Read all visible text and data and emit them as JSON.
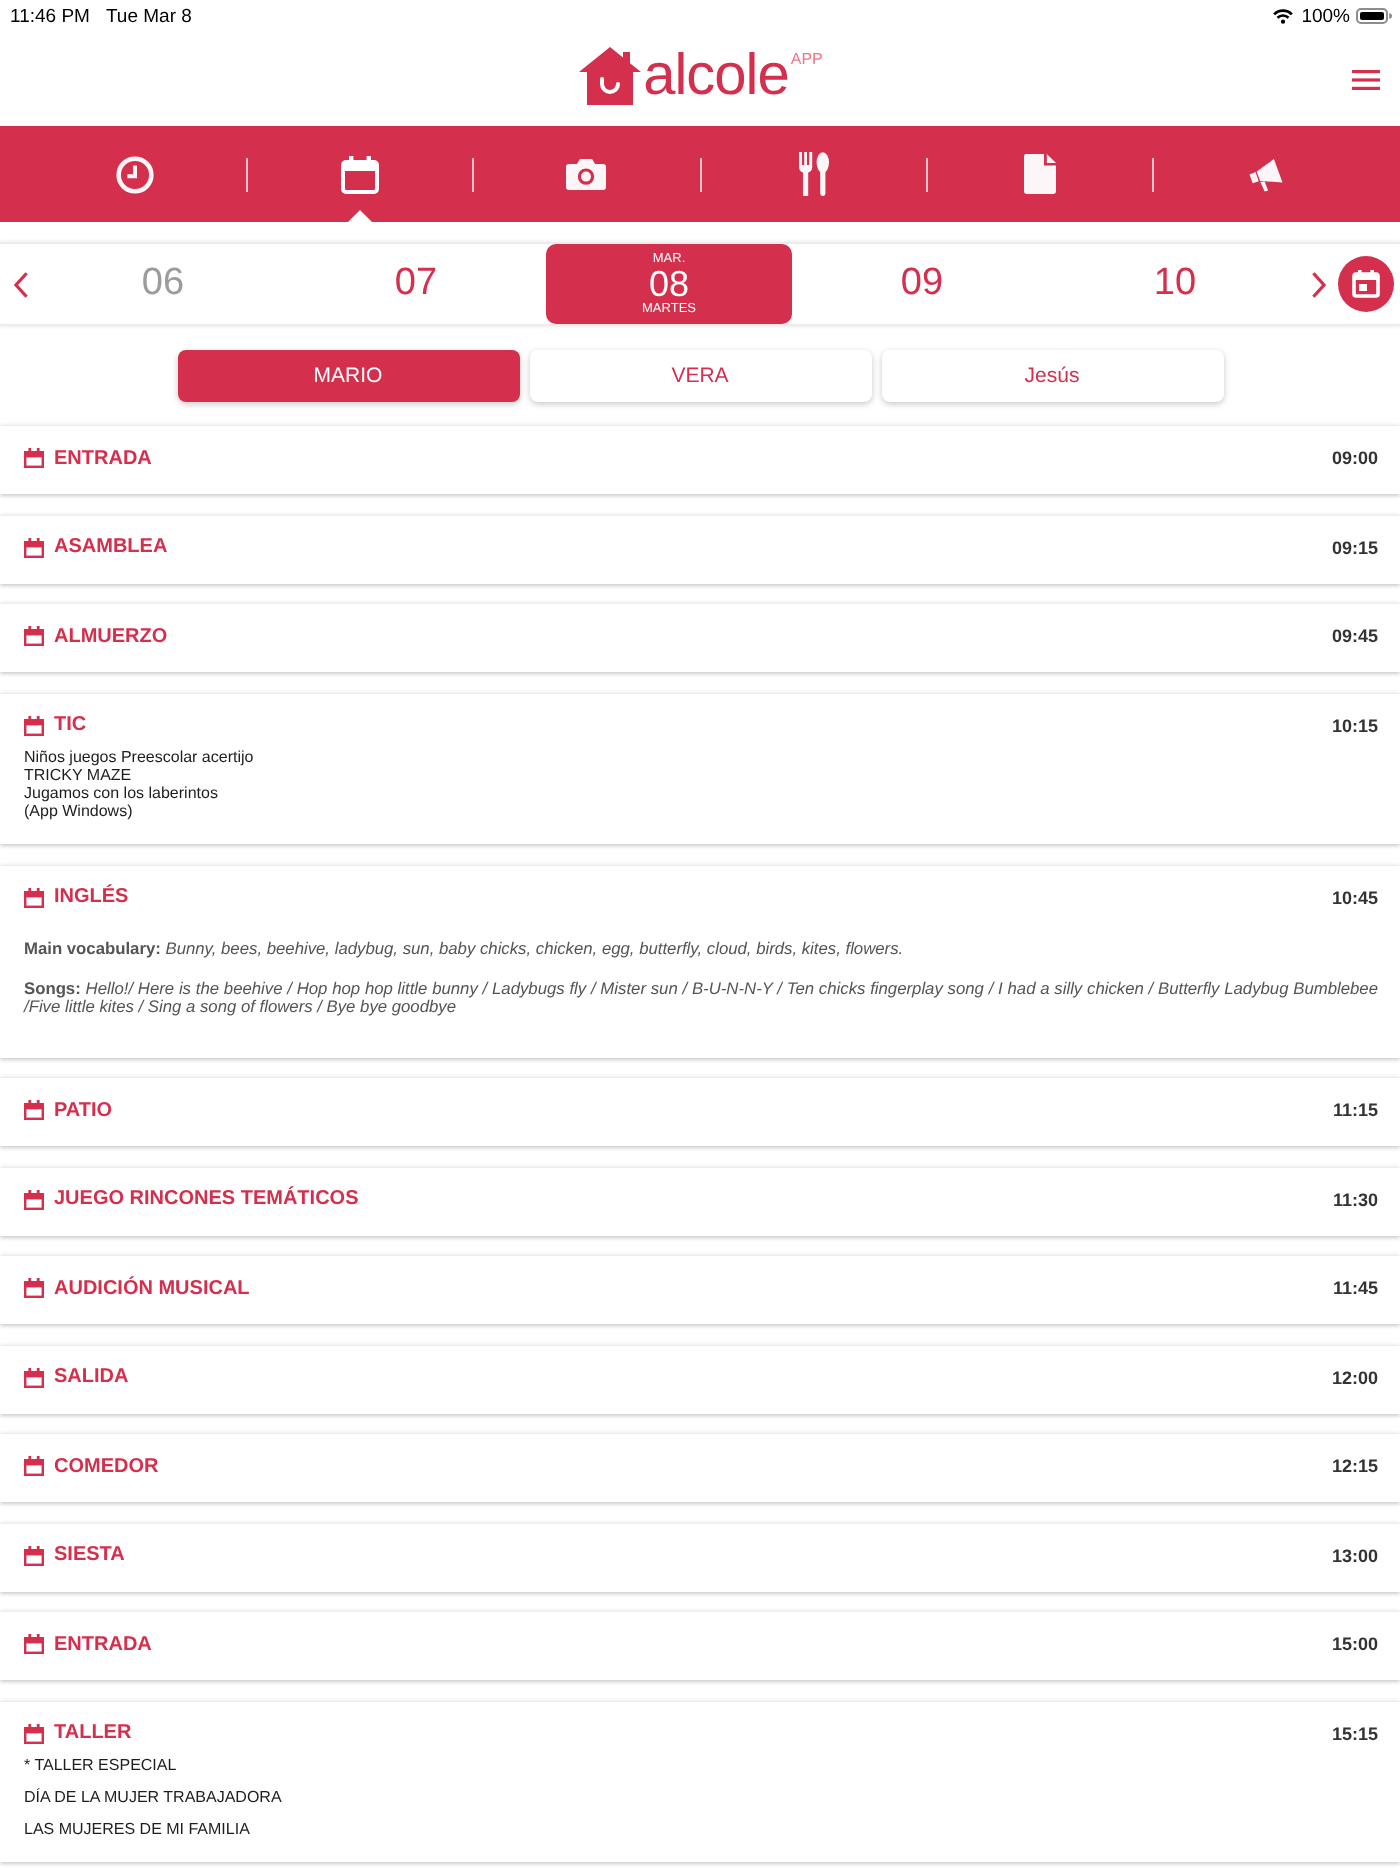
{
  "status_bar": {
    "time": "11:46 PM",
    "date": "Tue Mar 8",
    "battery": "100%"
  },
  "header": {
    "logo": "alcole",
    "badge": "APP"
  },
  "nav_tabs": [
    {
      "kind": "clock",
      "selected": false
    },
    {
      "kind": "calendar",
      "selected": true
    },
    {
      "kind": "camera",
      "selected": false
    },
    {
      "kind": "utensils",
      "selected": false
    },
    {
      "kind": "document",
      "selected": false
    },
    {
      "kind": "megaphone",
      "selected": false
    }
  ],
  "date_strip": {
    "days": [
      {
        "day": "06",
        "selected": false,
        "disabled": true
      },
      {
        "day": "07",
        "selected": false,
        "disabled": false
      },
      {
        "weekday_short": "MAR.",
        "day": "08",
        "weekday": "MARTES",
        "selected": true,
        "disabled": false
      },
      {
        "day": "09",
        "selected": false,
        "disabled": false
      },
      {
        "day": "10",
        "selected": false,
        "disabled": false
      }
    ]
  },
  "students": [
    {
      "name": "MARIO",
      "selected": true
    },
    {
      "name": "VERA",
      "selected": false
    },
    {
      "name": "Jesús",
      "selected": false
    }
  ],
  "schedule": [
    {
      "kind": "slot",
      "title": "ENTRADA",
      "time": "09:00"
    },
    {
      "kind": "slot",
      "title": "ASAMBLEA",
      "time": "09:15"
    },
    {
      "kind": "slot",
      "title": "ALMUERZO",
      "time": "09:45"
    },
    {
      "kind": "notes",
      "title": "TIC",
      "time": "10:15",
      "notes": [
        "Niños juegos Preescolar acertijo\nTRICKY MAZE\nJugamos con los laberintos\n(App Windows)"
      ]
    },
    {
      "kind": "formatted",
      "title": "INGLÉS",
      "time": "10:45",
      "notes": [
        "**Main vocabulary:** *Bunny, bees, beehive, ladybug, sun, baby chicks, chicken, egg, butterfly, cloud, birds, kites, flowers.*",
        "**Songs:** *Hello!/ Here is the beehive / Hop hop hop little bunny / Ladybugs fly / Mister sun / B-U-N-N-Y / Ten chicks fingerplay song / I had a silly chicken / Butterfly Ladybug Bumblebee /Five little kites / Sing a song of flowers / Bye bye goodbye*"
      ]
    },
    {
      "kind": "slot",
      "title": "PATIO",
      "time": "11:15"
    },
    {
      "kind": "slot",
      "title": "JUEGO RINCONES TEMÁTICOS",
      "time": "11:30"
    },
    {
      "kind": "slot",
      "title": "AUDICIÓN MUSICAL",
      "time": "11:45"
    },
    {
      "kind": "slot",
      "title": "SALIDA",
      "time": "12:00"
    },
    {
      "kind": "slot",
      "title": "COMEDOR",
      "time": "12:15"
    },
    {
      "kind": "slot",
      "title": "SIESTA",
      "time": "13:00"
    },
    {
      "kind": "slot",
      "title": "ENTRADA",
      "time": "15:00"
    },
    {
      "kind": "notes",
      "title": "TALLER",
      "time": "15:15",
      "notes": [
        "* TALLER ESPECIAL",
        "DÍA DE LA MUJER TRABAJADORA",
        "LAS MUJERES DE MI FAMILIA"
      ]
    }
  ]
}
